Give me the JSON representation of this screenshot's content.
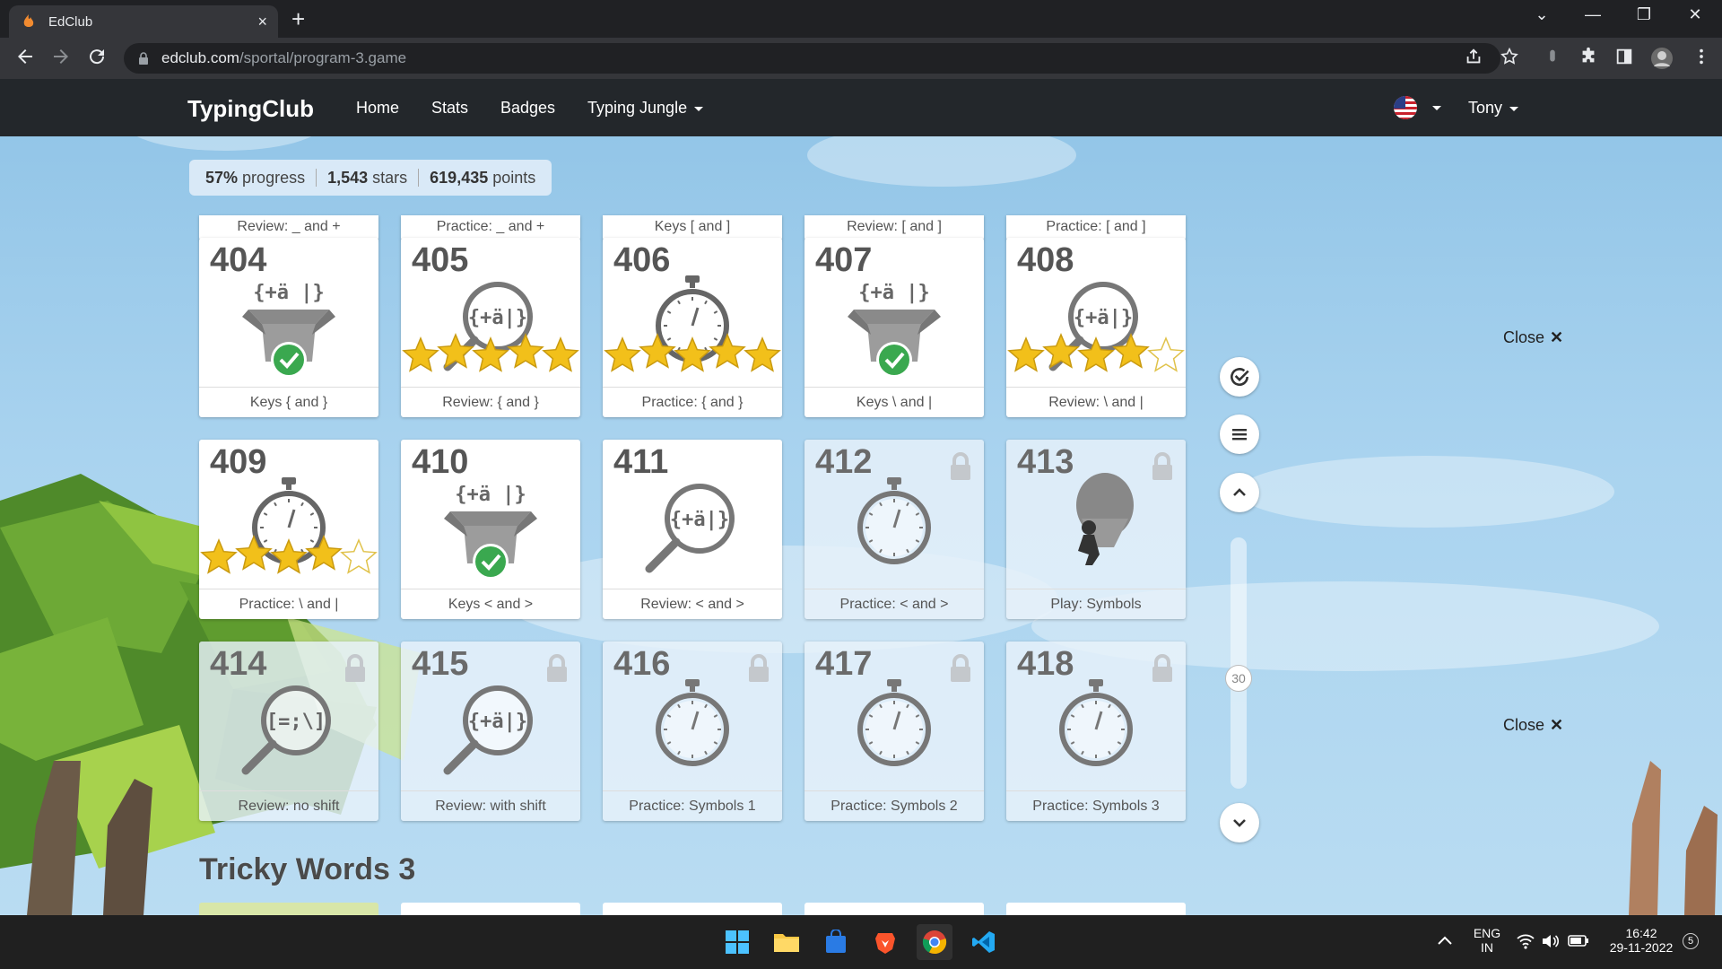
{
  "browser": {
    "tab_title": "EdClub",
    "tab_close": "×",
    "new_tab": "+",
    "url_host": "edclub.com",
    "url_path": "/sportal/program-3.game",
    "window_controls": [
      "⌄",
      "—",
      "❐",
      "✕"
    ]
  },
  "site": {
    "brand": "TypingClub",
    "nav": [
      "Home",
      "Stats",
      "Badges",
      "Typing Jungle"
    ],
    "user": "Tony"
  },
  "progress": {
    "percent": "57%",
    "percent_label": "progress",
    "stars": "1,543",
    "stars_label": "stars",
    "points": "619,435",
    "points_label": "points"
  },
  "top_strips": [
    "Review: _ and +",
    "Practice: _ and +",
    "Keys [ and ]",
    "Review: [ and ]",
    "Practice: [ and ]"
  ],
  "lessons": [
    {
      "num": "404",
      "caption": "Keys { and }",
      "type": "box",
      "glyph": "{+ä |}",
      "status": "done",
      "stars": 0,
      "locked": false
    },
    {
      "num": "405",
      "caption": "Review: { and }",
      "type": "magnifier",
      "glyph": "{+ä|}",
      "status": "stars",
      "stars": 5,
      "locked": false
    },
    {
      "num": "406",
      "caption": "Practice: { and }",
      "type": "stopwatch",
      "glyph": "",
      "status": "stars",
      "stars": 5,
      "locked": false
    },
    {
      "num": "407",
      "caption": "Keys \\ and |",
      "type": "box",
      "glyph": "{+ä |}",
      "status": "done",
      "stars": 0,
      "locked": false
    },
    {
      "num": "408",
      "caption": "Review: \\ and |",
      "type": "magnifier",
      "glyph": "{+ä|}",
      "status": "stars",
      "stars": 4,
      "locked": false
    },
    {
      "num": "409",
      "caption": "Practice: \\ and |",
      "type": "stopwatch",
      "glyph": "",
      "status": "stars",
      "stars": 4,
      "locked": false
    },
    {
      "num": "410",
      "caption": "Keys < and >",
      "type": "box",
      "glyph": "{+ä |}",
      "status": "done",
      "stars": 0,
      "locked": false
    },
    {
      "num": "411",
      "caption": "Review: < and >",
      "type": "magnifier",
      "glyph": "{+ä|}",
      "status": "none",
      "stars": 0,
      "locked": false
    },
    {
      "num": "412",
      "caption": "Practice: < and >",
      "type": "stopwatch",
      "glyph": "",
      "status": "none",
      "stars": 0,
      "locked": true
    },
    {
      "num": "413",
      "caption": "Play: Symbols",
      "type": "balloon",
      "glyph": "",
      "status": "none",
      "stars": 0,
      "locked": true
    },
    {
      "num": "414",
      "caption": "Review: no shift",
      "type": "magnifier",
      "glyph": "[=;\\]",
      "status": "none",
      "stars": 0,
      "locked": true
    },
    {
      "num": "415",
      "caption": "Review: with shift",
      "type": "magnifier",
      "glyph": "{+ä|}",
      "status": "none",
      "stars": 0,
      "locked": true
    },
    {
      "num": "416",
      "caption": "Practice: Symbols 1",
      "type": "stopwatch",
      "glyph": "",
      "status": "none",
      "stars": 0,
      "locked": true
    },
    {
      "num": "417",
      "caption": "Practice: Symbols 2",
      "type": "stopwatch",
      "glyph": "",
      "status": "none",
      "stars": 0,
      "locked": true
    },
    {
      "num": "418",
      "caption": "Practice: Symbols 3",
      "type": "stopwatch",
      "glyph": "",
      "status": "none",
      "stars": 0,
      "locked": true
    }
  ],
  "section_title": "Tricky Words 3",
  "side_controls": {
    "scroll_label": "30",
    "icons": [
      "check-circle-icon",
      "menu-icon",
      "chevron-up-icon",
      "chevron-down-icon"
    ]
  },
  "close_label": "Close",
  "close_x": "✕",
  "taskbar": {
    "lang_top": "ENG",
    "lang_bottom": "IN",
    "time": "16:42",
    "date": "29-11-2022",
    "notif_count": "5"
  },
  "colors": {
    "nav_bg": "#23272b",
    "star": "#f2c01a",
    "check": "#3aa84f",
    "icon_grey": "#777777"
  }
}
